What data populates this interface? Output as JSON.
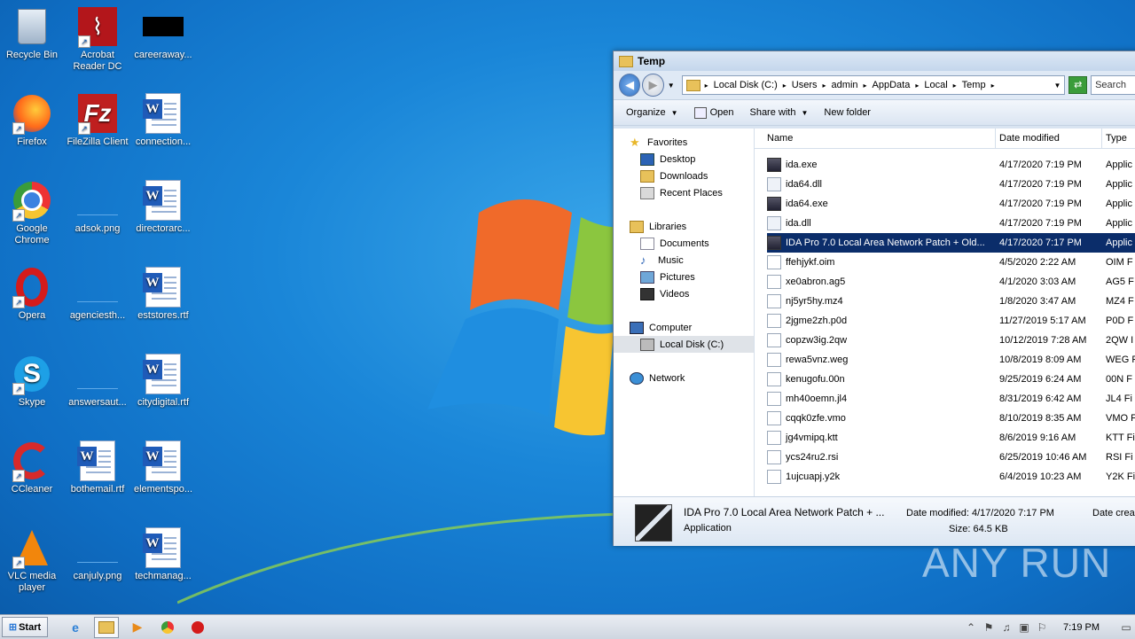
{
  "desktop": {
    "icons": [
      {
        "label": "Recycle Bin"
      },
      {
        "label": "Acrobat Reader DC"
      },
      {
        "label": "careeraway..."
      },
      {
        "label": "Firefox"
      },
      {
        "label": "FileZilla Client"
      },
      {
        "label": "connection..."
      },
      {
        "label": "Google Chrome"
      },
      {
        "label": "adsok.png"
      },
      {
        "label": "directorarc..."
      },
      {
        "label": "Opera"
      },
      {
        "label": "agenciesth..."
      },
      {
        "label": "eststores.rtf"
      },
      {
        "label": "Skype"
      },
      {
        "label": "answersaut..."
      },
      {
        "label": "citydigital.rtf"
      },
      {
        "label": "CCleaner"
      },
      {
        "label": "bothemail.rtf"
      },
      {
        "label": "elementspo..."
      },
      {
        "label": "VLC media player"
      },
      {
        "label": "canjuly.png"
      },
      {
        "label": "techmanag..."
      }
    ]
  },
  "watermark": "ANY RUN",
  "window": {
    "title": "Temp",
    "address": [
      "Local Disk (C:)",
      "Users",
      "admin",
      "AppData",
      "Local",
      "Temp"
    ],
    "search_placeholder": "Search",
    "toolbar": {
      "organize": "Organize",
      "open": "Open",
      "share": "Share with",
      "new_folder": "New folder"
    },
    "nav": {
      "favorites": "Favorites",
      "desktop": "Desktop",
      "downloads": "Downloads",
      "recent": "Recent Places",
      "libraries": "Libraries",
      "documents": "Documents",
      "music": "Music",
      "pictures": "Pictures",
      "videos": "Videos",
      "computer": "Computer",
      "local_disk": "Local Disk (C:)",
      "network": "Network"
    },
    "columns": {
      "name": "Name",
      "date": "Date modified",
      "type": "Type"
    },
    "files": [
      {
        "name": "ida.exe",
        "date": "4/17/2020 7:19 PM",
        "type": "Applic"
      },
      {
        "name": "ida64.dll",
        "date": "4/17/2020 7:19 PM",
        "type": "Applic"
      },
      {
        "name": "ida64.exe",
        "date": "4/17/2020 7:19 PM",
        "type": "Applic"
      },
      {
        "name": "ida.dll",
        "date": "4/17/2020 7:19 PM",
        "type": "Applic"
      },
      {
        "name": "IDA Pro 7.0 Local  Area Network Patch + Old...",
        "date": "4/17/2020 7:17 PM",
        "type": "Applic"
      },
      {
        "name": "ffehjykf.oim",
        "date": "4/5/2020 2:22 AM",
        "type": "OIM F"
      },
      {
        "name": "xe0abron.ag5",
        "date": "4/1/2020 3:03 AM",
        "type": "AG5 F"
      },
      {
        "name": "nj5yr5hy.mz4",
        "date": "1/8/2020 3:47 AM",
        "type": "MZ4 F"
      },
      {
        "name": "2jgme2zh.p0d",
        "date": "11/27/2019 5:17 AM",
        "type": "P0D F"
      },
      {
        "name": "copzw3ig.2qw",
        "date": "10/12/2019 7:28 AM",
        "type": "2QW I"
      },
      {
        "name": "rewa5vnz.weg",
        "date": "10/8/2019 8:09 AM",
        "type": "WEG F"
      },
      {
        "name": "kenugofu.00n",
        "date": "9/25/2019 6:24 AM",
        "type": "00N F"
      },
      {
        "name": "mh40oemn.jl4",
        "date": "8/31/2019 6:42 AM",
        "type": "JL4 Fi"
      },
      {
        "name": "cqqk0zfe.vmo",
        "date": "8/10/2019 8:35 AM",
        "type": "VMO F"
      },
      {
        "name": "jg4vmipq.ktt",
        "date": "8/6/2019 9:16 AM",
        "type": "KTT Fi"
      },
      {
        "name": "ycs24ru2.rsi",
        "date": "6/25/2019 10:46 AM",
        "type": "RSI Fi"
      },
      {
        "name": "1ujcuapj.y2k",
        "date": "6/4/2019 10:23 AM",
        "type": "Y2K Fi"
      }
    ],
    "details": {
      "name": "IDA Pro 7.0 Local  Area Network Patch + ...",
      "kind": "Application",
      "date_modified": "Date modified: 4/17/2020 7:17 PM",
      "size": "Size: 64.5 KB",
      "date_created": "Date crea"
    }
  },
  "taskbar": {
    "start": "Start",
    "clock": "7:19 PM"
  }
}
